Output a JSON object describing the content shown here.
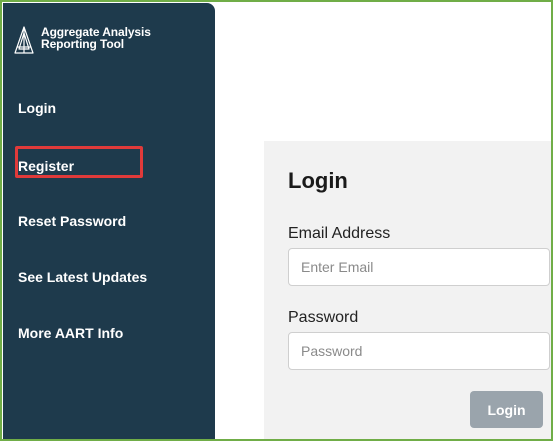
{
  "app": {
    "name_line1": "Aggregate Analysis",
    "name_line2": "Reporting Tool",
    "logo_icon": "aart-a-logo-icon"
  },
  "sidebar": {
    "items": [
      {
        "label": "Login"
      },
      {
        "label": "Register",
        "highlighted": true
      },
      {
        "label": "Reset Password"
      },
      {
        "label": "See Latest Updates"
      },
      {
        "label": "More AART Info"
      }
    ]
  },
  "login_form": {
    "title": "Login",
    "email_label": "Email Address",
    "email_placeholder": "Enter Email",
    "password_label": "Password",
    "password_placeholder": "Password",
    "submit_label": "Login"
  },
  "colors": {
    "sidebar_bg": "#1e3a4c",
    "frame_border": "#70ad47",
    "highlight": "#e03a3a",
    "card_bg": "#f2f2f2",
    "button_bg": "#9aa4ac"
  }
}
